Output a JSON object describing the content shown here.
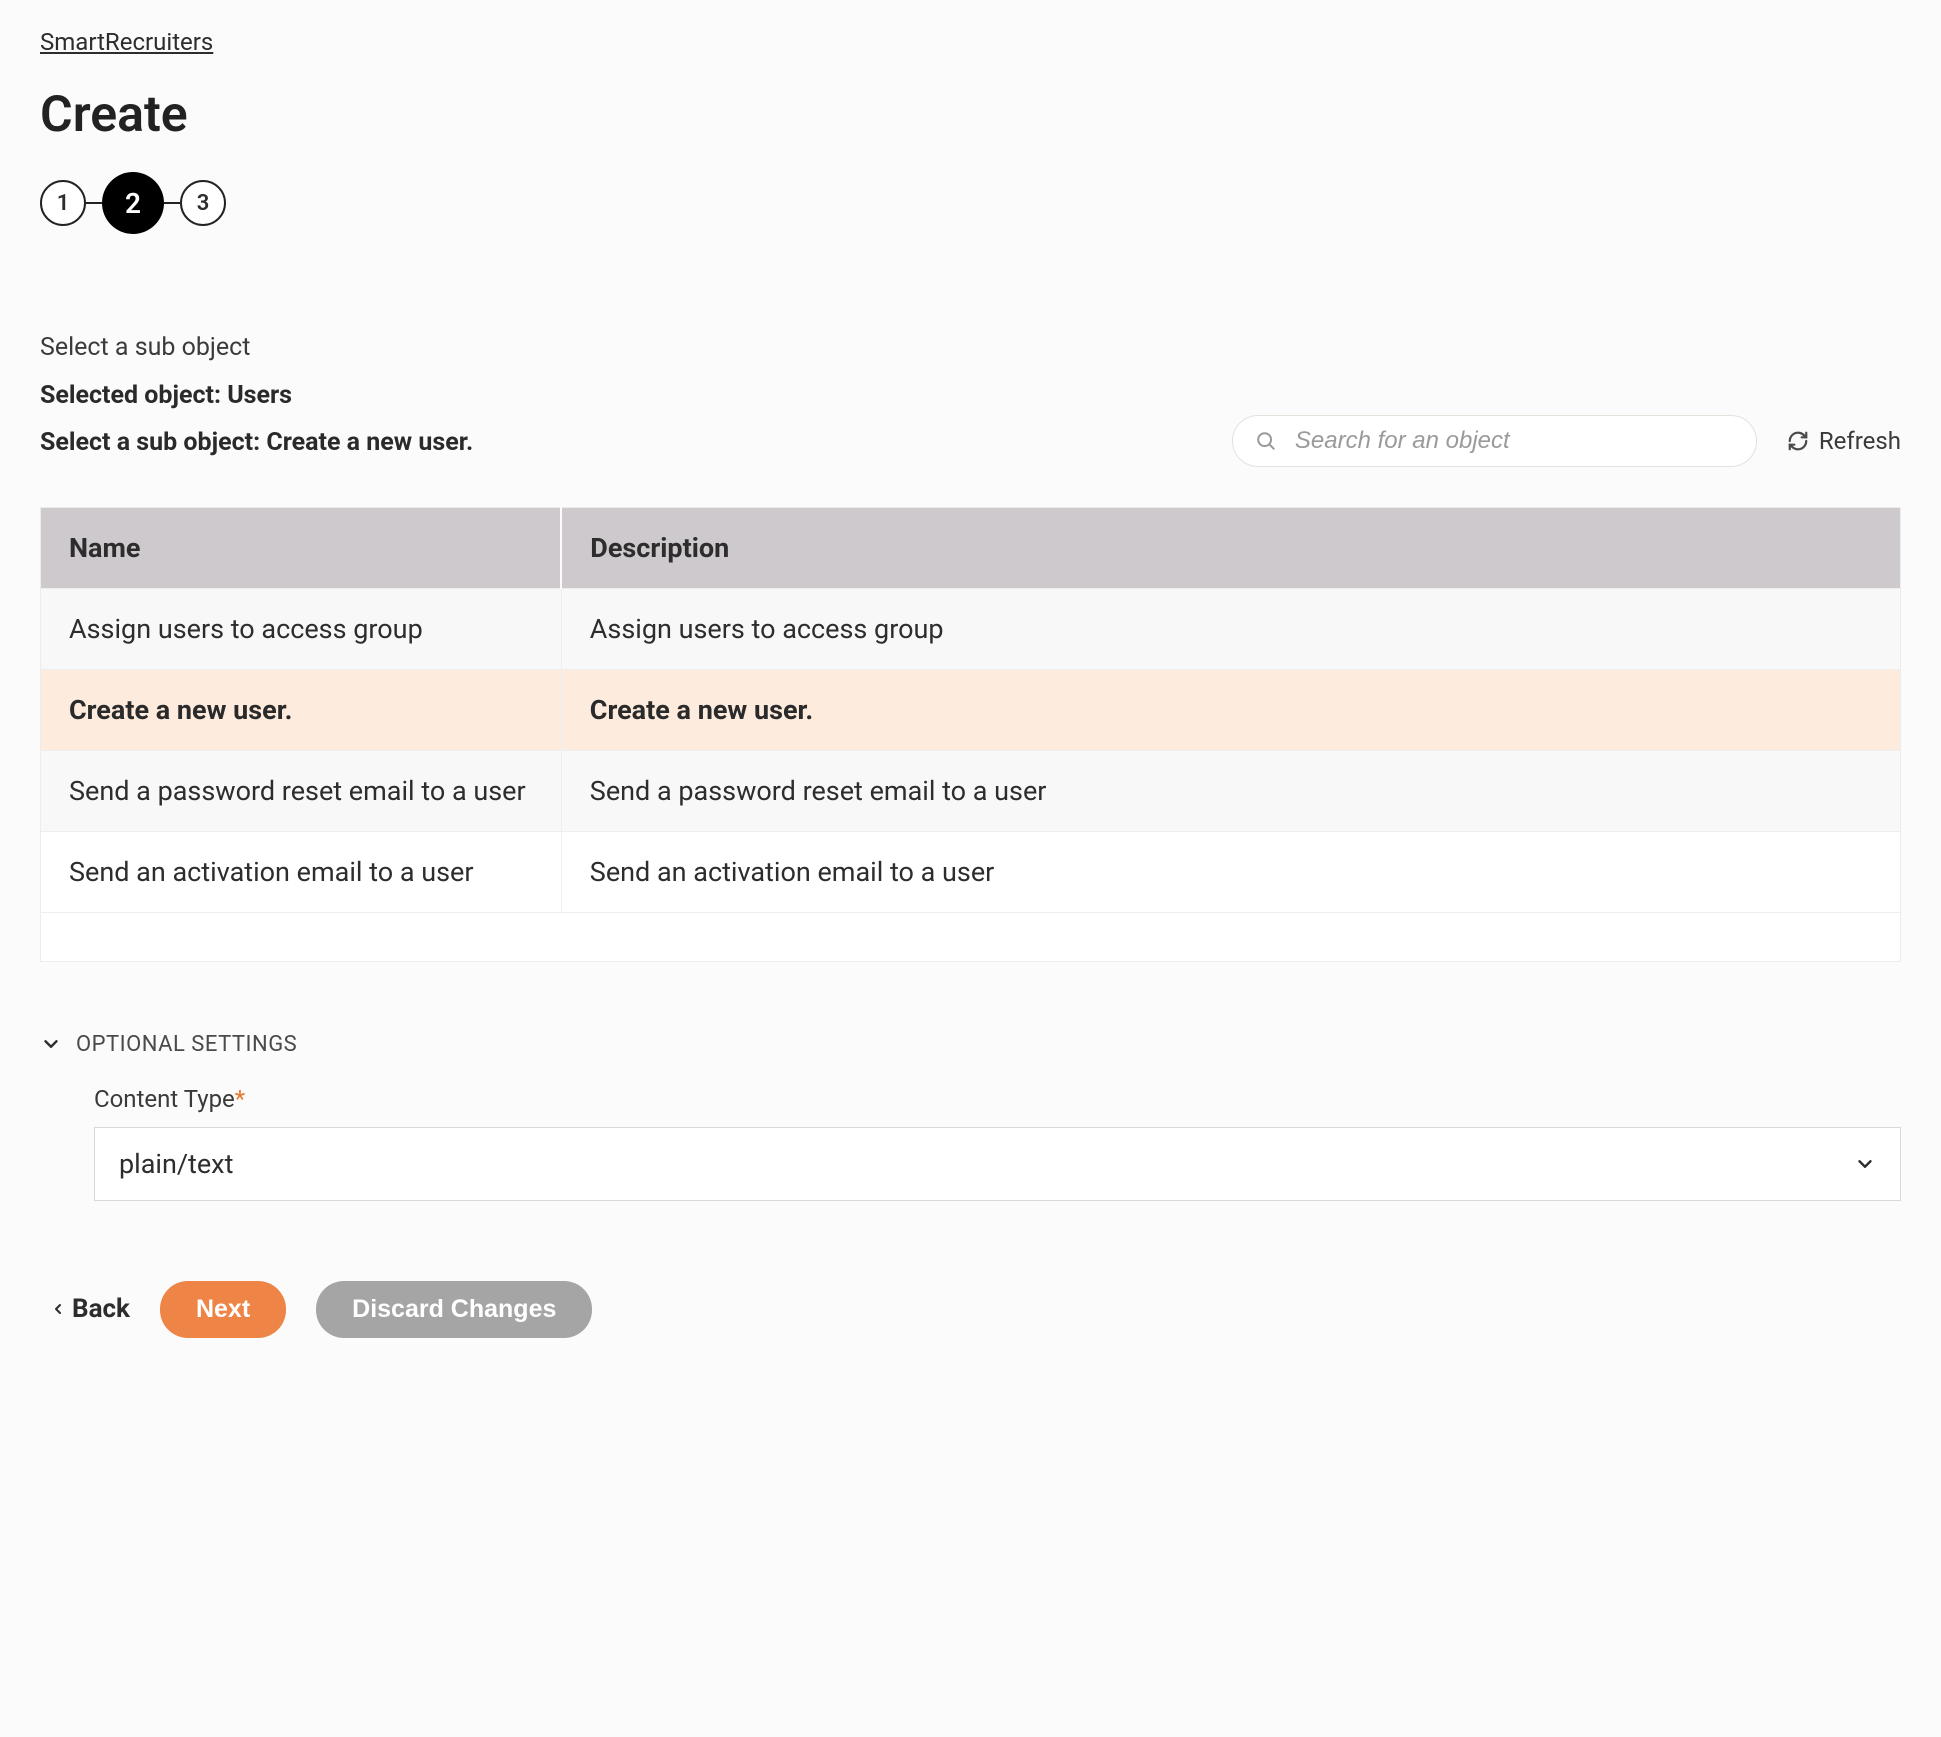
{
  "breadcrumb": "SmartRecruiters",
  "page_title": "Create",
  "stepper": {
    "steps": [
      "1",
      "2",
      "3"
    ],
    "active_index": 1
  },
  "header": {
    "hint": "Select a sub object",
    "selected_object_label": "Selected object: Users",
    "select_sub_label": "Select a sub object: Create a new user."
  },
  "search": {
    "placeholder": "Search for an object",
    "value": ""
  },
  "refresh_label": "Refresh",
  "table": {
    "columns": [
      "Name",
      "Description"
    ],
    "rows": [
      {
        "name": "Assign users to access group",
        "description": "Assign users to access group",
        "selected": false
      },
      {
        "name": "Create a new user.",
        "description": "Create a new user.",
        "selected": true
      },
      {
        "name": "Send a password reset email to a user",
        "description": "Send a password reset email to a user",
        "selected": false
      },
      {
        "name": "Send an activation email to a user",
        "description": "Send an activation email to a user",
        "selected": false
      }
    ]
  },
  "optional": {
    "heading": "OPTIONAL SETTINGS",
    "content_type_label": "Content Type",
    "required_marker": "*",
    "content_type_value": "plain/text"
  },
  "footer": {
    "back": "Back",
    "next": "Next",
    "discard": "Discard Changes"
  }
}
